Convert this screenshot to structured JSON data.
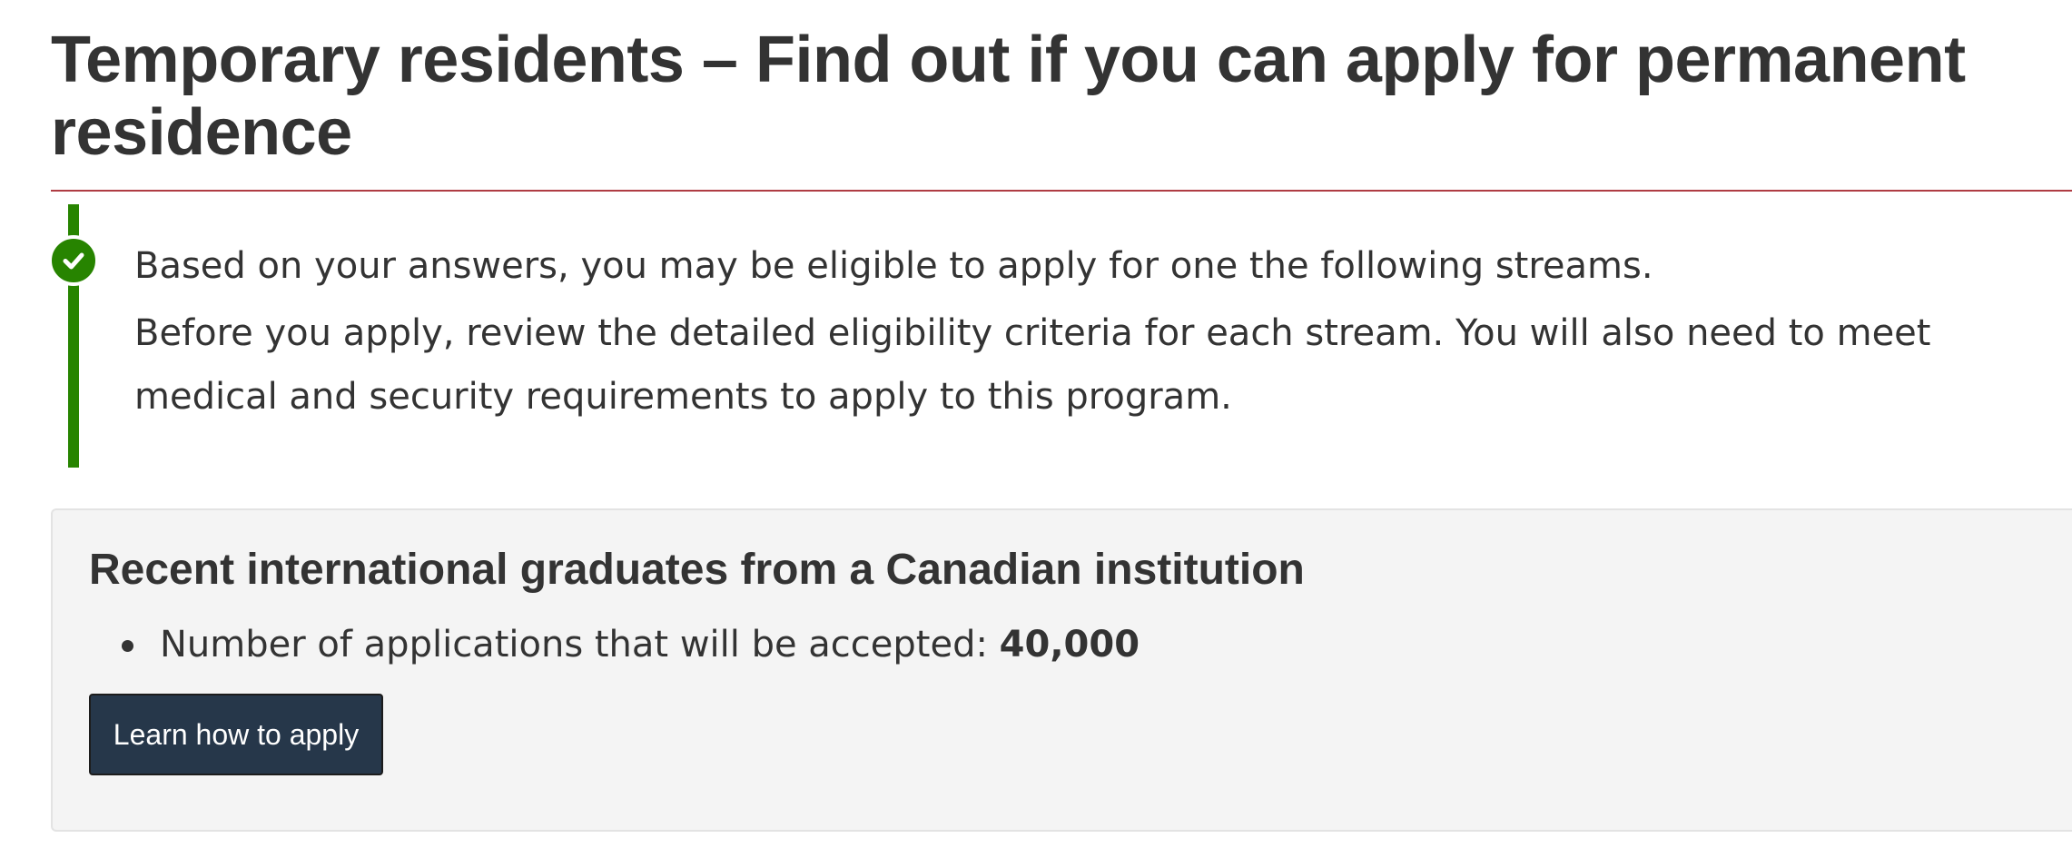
{
  "page": {
    "title": "Temporary residents – Find out if you can apply for permanent residence"
  },
  "alert": {
    "status": "success",
    "icon": "check-circle-icon",
    "color": "#278400",
    "message_1": "Based on your answers, you may be eligible to apply for one the following streams.",
    "message_2": "Before you apply, review the detailed eligibility criteria for each stream. You will also need to meet medical and security requirements to apply to this program."
  },
  "stream": {
    "title": "Recent international graduates from a Canadian institution",
    "items": [
      {
        "label": "Number of applications that will be accepted: ",
        "value": "40,000"
      }
    ],
    "button_label": "Learn how to apply"
  },
  "colors": {
    "title_rule": "#af3c43",
    "button_bg": "#26374a",
    "panel_bg": "#f4f4f4"
  }
}
